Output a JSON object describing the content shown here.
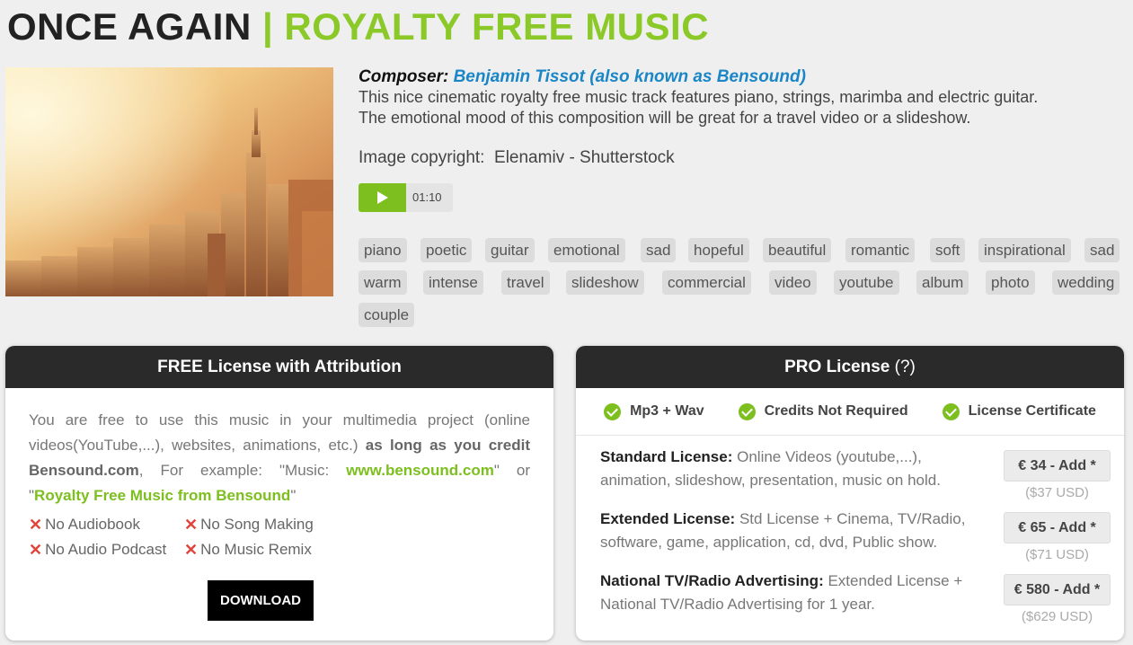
{
  "header": {
    "title_main": "ONCE AGAIN",
    "title_sep": "|",
    "title_category": "ROYALTY FREE MUSIC"
  },
  "track": {
    "composer_label": "Composer:",
    "composer_name": "Benjamin Tissot (also known as Bensound)",
    "description_line1": "This nice cinematic royalty free music track features piano, strings, marimba and electric guitar.",
    "description_line2": "The emotional mood of this composition will be great for a travel video or a slideshow.",
    "image_copyright_label": "Image copyright:",
    "image_copyright_value": "Elenamiv - Shutterstock",
    "duration": "01:10",
    "play_icon": "play-icon"
  },
  "tags": [
    "piano",
    "poetic",
    "guitar",
    "emotional",
    "sad",
    "hopeful",
    "beautiful",
    "romantic",
    "soft",
    "inspirational",
    "sad",
    "warm",
    "intense",
    "travel",
    "slideshow",
    "commercial",
    "video",
    "youtube",
    "album",
    "photo",
    "wedding",
    "couple"
  ],
  "free_license": {
    "heading": "FREE License with Attribution",
    "text_intro": "You are free to use this music in your multimedia project (online videos(YouTube,...), websites, animations, etc.)",
    "text_bold": "as long as you credit Bensound.com",
    "text_example": ", For example: \"Music:",
    "link_site": "www.bensound.com",
    "text_or": "\" or \"",
    "link_name": "Royalty Free Music from Bensound",
    "text_end": "\"",
    "restrictions": [
      "No Audiobook",
      "No Song Making",
      "No Audio Podcast",
      "No Music Remix"
    ],
    "download_label": "DOWNLOAD"
  },
  "pro_license": {
    "heading": "PRO License",
    "help": "(?)",
    "features": [
      "Mp3 + Wav",
      "Credits Not Required",
      "License Certificate"
    ],
    "licenses": [
      {
        "name": "Standard License:",
        "desc": "Online Videos (youtube,...), animation, slideshow, presentation, music on hold.",
        "button": "€ 34 - Add *",
        "usd": "($37 USD)"
      },
      {
        "name": "Extended License:",
        "desc": "Std License + Cinema, TV/Radio, software, game, application, cd, dvd, Public show.",
        "button": "€ 65 - Add *",
        "usd": "($71 USD)"
      },
      {
        "name": "National TV/Radio Advertising:",
        "desc": "Extended License + National TV/Radio Advertising for 1 year.",
        "button": "€ 580 - Add *",
        "usd": "($629 USD)"
      }
    ]
  },
  "colors": {
    "accent_green": "#8bc928",
    "link_blue": "#1b86c6",
    "dark_header": "#2a2a2a",
    "cross_red": "#e0443b"
  }
}
